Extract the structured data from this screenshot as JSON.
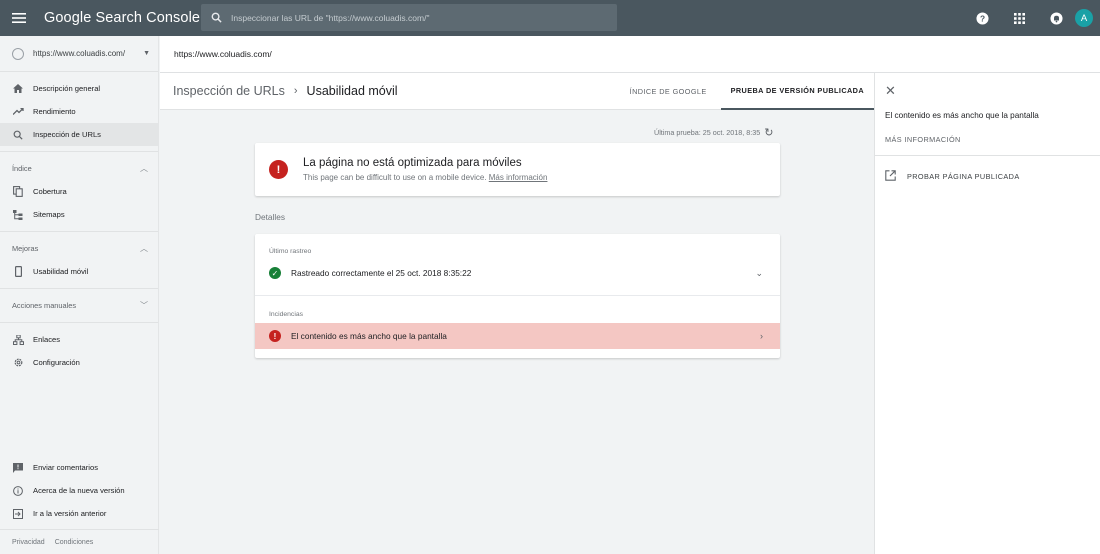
{
  "header": {
    "app_title": "Google Search Console",
    "search_placeholder": "Inspeccionar las URL de \"https://www.coluadis.com/\"",
    "avatar_letter": "A"
  },
  "sidebar": {
    "property": "https://www.coluadis.com/",
    "items": [
      {
        "label": "Descripción general",
        "icon": "home-icon"
      },
      {
        "label": "Rendimiento",
        "icon": "trending-up-icon"
      },
      {
        "label": "Inspección de URLs",
        "icon": "search-icon",
        "active": true
      }
    ],
    "sections": {
      "index": {
        "label": "Índice",
        "items": [
          "Cobertura",
          "Sitemaps"
        ]
      },
      "improvements": {
        "label": "Mejoras",
        "items": [
          "Usabilidad móvil"
        ]
      },
      "manual": {
        "label": "Acciones manuales"
      }
    },
    "extra_items": [
      "Enlaces",
      "Configuración"
    ],
    "bottom_items": [
      "Enviar comentarios",
      "Acerca de la nueva versión",
      "Ir a la versión anterior"
    ],
    "footer": [
      "Privacidad",
      "Condiciones"
    ]
  },
  "urlbar": {
    "url": "https://www.coluadis.com/"
  },
  "main": {
    "breadcrumb": {
      "parent": "Inspección de URLs",
      "current": "Usabilidad móvil"
    },
    "tabs": [
      "ÍNDICE DE GOOGLE",
      "PRUEBA DE VERSIÓN PUBLICADA"
    ],
    "active_tab": 1,
    "last_test": "Última prueba: 25 oct. 2018, 8:35",
    "alert": {
      "title": "La página no está optimizada para móviles",
      "subtitle": "This page can be difficult to use on a mobile device.",
      "link": "Más información"
    },
    "details_label": "Detalles",
    "last_crawl": {
      "label": "Último rastreo",
      "text": "Rastreado correctamente el 25 oct. 2018 8:35:22"
    },
    "issues": {
      "label": "Incidencias",
      "text": "El contenido es más ancho que la pantalla"
    }
  },
  "panel": {
    "title": "El contenido es más ancho que la pantalla",
    "more_info": "MÁS INFORMACIÓN",
    "action": "PROBAR PÁGINA PUBLICADA"
  },
  "colors": {
    "topbar": "#4a575f",
    "error": "#c5221f",
    "success": "#188038",
    "issue_bg": "#f4c7c3",
    "avatar": "#1aa1a6"
  }
}
